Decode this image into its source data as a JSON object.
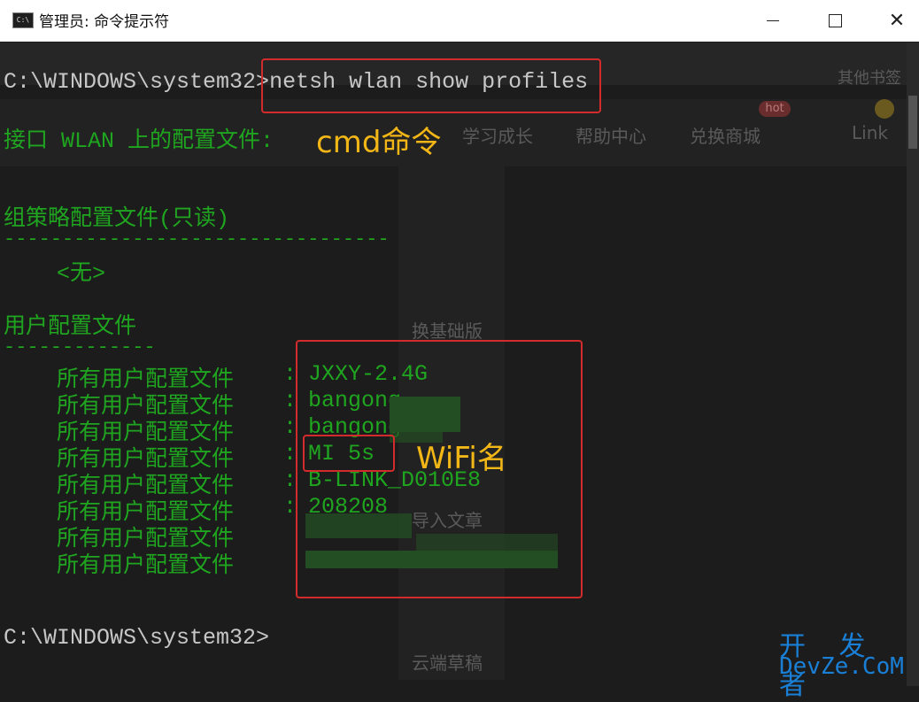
{
  "window": {
    "title": "管理员: 命令提示符",
    "icon_label": "C:\\"
  },
  "background_browser": {
    "bookmarks": [
      "其他书签"
    ],
    "nav_items": [
      "学习成长",
      "帮助中心",
      "兑换商城",
      "Link"
    ],
    "hot_badge": "hot",
    "side_items": [
      "换基础版",
      "导入文章",
      "云端草稿"
    ]
  },
  "terminal": {
    "prompt_1": "C:\\WINDOWS\\system32>",
    "command": "netsh wlan show profiles",
    "iface_line": "接口 WLAN 上的配置文件:",
    "group_header": "组策略配置文件(只读)",
    "group_dash": "---------------------------------",
    "group_none": "<无>",
    "user_header": "用户配置文件",
    "user_dash": "-------------",
    "profile_label": "所有用户配置文件",
    "profiles": [
      "JXXY-2.4G",
      "bangong",
      "bangong",
      "MI 5s",
      "B-LINK_D010E8",
      "208208",
      "",
      ""
    ],
    "prompt_2": "C:\\WINDOWS\\system32>"
  },
  "annotations": {
    "cmd_label": "cmd命令",
    "wifi_label": "WiFi名",
    "color": "#f2b616",
    "box_color": "#d32b2b"
  },
  "watermark": {
    "line1": "开 发 者",
    "line2": "DevZe.CoM"
  }
}
